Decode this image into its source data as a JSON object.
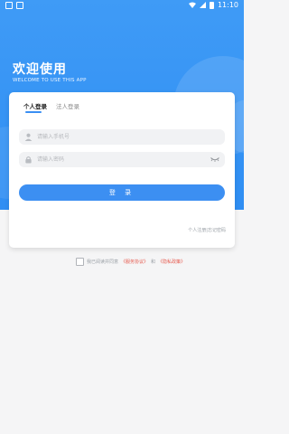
{
  "status_bar": {
    "time": "11:10"
  },
  "welcome": {
    "title": "欢迎使用",
    "subtitle": "WELCOME TO USE THIS APP"
  },
  "tabs": [
    {
      "label": "个人登录",
      "active": true
    },
    {
      "label": "法人登录",
      "active": false
    }
  ],
  "form": {
    "phone_placeholder": "请输入手机号",
    "password_placeholder": "请输入密码",
    "login_label": "登 录"
  },
  "links": {
    "register": "个人注册",
    "separator": "|",
    "forgot": "忘记密码"
  },
  "agreement": {
    "prefix": "我已阅读并同意",
    "service": "《服务协议》",
    "and": "和",
    "privacy": "《隐私政策》"
  },
  "colors": {
    "primary": "#3c8ff2",
    "link_red": "#e65a4e",
    "background": "#f5f5f6"
  }
}
